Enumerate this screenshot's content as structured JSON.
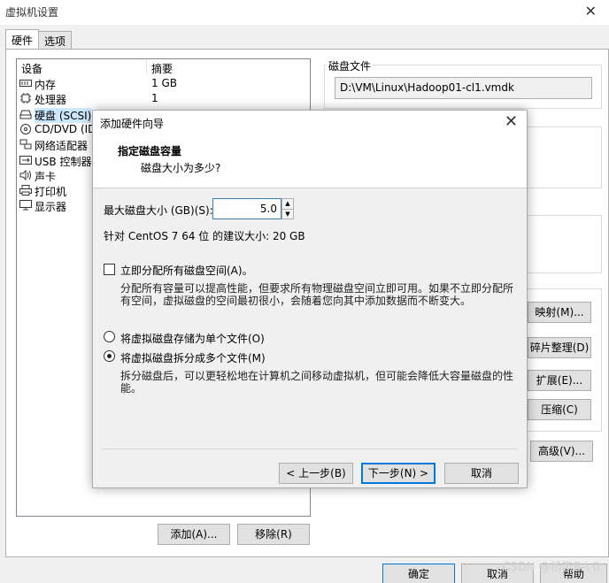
{
  "window": {
    "title": "虚拟机设置"
  },
  "tabs": [
    {
      "label": "硬件"
    },
    {
      "label": "选项"
    }
  ],
  "devices": {
    "col_device": "设备",
    "col_summary": "摘要",
    "rows": [
      {
        "name": "内存",
        "summary": "1 GB",
        "icon": "memory-icon"
      },
      {
        "name": "处理器",
        "summary": "1",
        "icon": "cpu-icon"
      },
      {
        "name": "硬盘 (SCSI)",
        "summary": "",
        "icon": "harddisk-icon"
      },
      {
        "name": "CD/DVD (IDE)",
        "summary": "",
        "icon": "cd-icon"
      },
      {
        "name": "网络适配器",
        "summary": "",
        "icon": "network-icon"
      },
      {
        "name": "USB 控制器",
        "summary": "",
        "icon": "usb-icon"
      },
      {
        "name": "声卡",
        "summary": "",
        "icon": "sound-icon"
      },
      {
        "name": "打印机",
        "summary": "",
        "icon": "printer-icon"
      },
      {
        "name": "显示器",
        "summary": "",
        "icon": "monitor-icon"
      }
    ],
    "add_label": "添加(A)...",
    "remove_label": "移除(R)"
  },
  "disk": {
    "file_group_label": "磁盘文件",
    "file_path": "D:\\VM\\Linux\\Hadoop01-cl1.vmdk",
    "map_label": "映射(M)...",
    "defrag_label": "碎片整理(D)",
    "expand_label": "扩展(E)...",
    "compact_label": "压缩(C)",
    "advanced_label": "高级(V)..."
  },
  "footer": {
    "ok_label": "确定",
    "cancel_label": "取消",
    "help_label": "帮助",
    "watermark": "CSDN @杨歌B-\\ 0"
  },
  "wizard": {
    "title": "添加硬件向导",
    "heading": "指定磁盘容量",
    "subheading": "磁盘大小为多少?",
    "max_size_label": "最大磁盘大小 (GB)(S):",
    "max_size_value": "5.0",
    "recommend_text": "针对 CentOS 7 64 位 的建议大小: 20 GB",
    "allocate_label": "立即分配所有磁盘空间(A)。",
    "allocate_desc_1": "分配所有容量可以提高性能，但要求所有物理磁盘空间立即可用。如果不立即分配所",
    "allocate_desc_2": "有空间，虚拟磁盘的空间最初很小，会随着您向其中添加数据而不断变大。",
    "single_file_label": "将虚拟磁盘存储为单个文件(O)",
    "split_file_label": "将虚拟磁盘拆分成多个文件(M)",
    "split_desc_1": "拆分磁盘后，可以更轻松地在计算机之间移动虚拟机，但可能会降低大容量磁盘的性",
    "split_desc_2": "能。",
    "back_label": "< 上一步(B)",
    "next_label": "下一步(N) >",
    "cancel_label": "取消",
    "split_selected": true
  }
}
